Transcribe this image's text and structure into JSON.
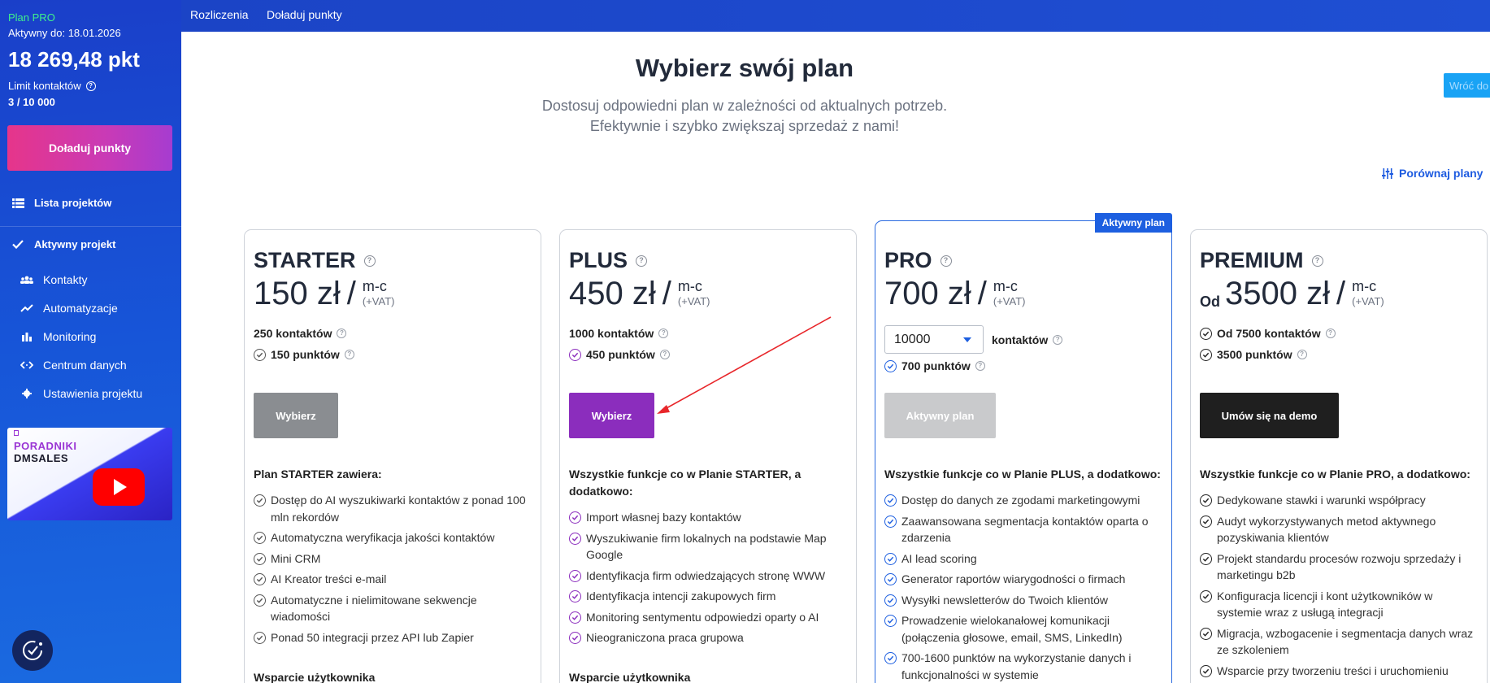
{
  "sidebar": {
    "plan_name": "Plan PRO",
    "active_until": "Aktywny do: 18.01.2026",
    "points": "18 269,48 pkt",
    "limit_label": "Limit kontaktów",
    "limit_value": "3 / 10 000",
    "topup_button": "Doładuj punkty",
    "project_list": "Lista projektów",
    "active_project": "Aktywny projekt",
    "items": [
      {
        "label": "Kontakty",
        "icon": "contacts-icon"
      },
      {
        "label": "Automatyzacje",
        "icon": "trend-icon"
      },
      {
        "label": "Monitoring",
        "icon": "bar-chart-icon"
      },
      {
        "label": "Centrum danych",
        "icon": "code-arrows-icon"
      },
      {
        "label": "Ustawienia projektu",
        "icon": "gear-icon"
      }
    ],
    "video": {
      "line1": "PORADNIKI",
      "line2": "DMSALES"
    }
  },
  "topbar": {
    "links": [
      "Rozliczenia",
      "Doładuj punkty"
    ]
  },
  "header": {
    "title": "Wybierz swój plan",
    "subtitle_line1": "Dostosuj odpowiedni plan w zależności od aktualnych potrzeb.",
    "subtitle_line2": "Efektywnie i szybko zwiększaj sprzedaż z nami!",
    "back_button": "Wróć do",
    "compare_link": "Porównaj plany"
  },
  "colors": {
    "starter": "#8a8d91",
    "plus": "#8b2dbd",
    "pro": "#1d5fe0",
    "premium": "#222222"
  },
  "plans": {
    "starter": {
      "name": "STARTER",
      "price": "150 zł",
      "per": "m-c",
      "vat": "(+VAT)",
      "contacts": "250  kontaktów",
      "points": "150 punktów",
      "button": "Wybierz",
      "features_head": "Plan STARTER zawiera:",
      "features": [
        "Dostęp do AI wyszukiwarki kontaktów z ponad 100 mln rekordów",
        "Automatyczna weryfikacja jakości kontaktów",
        "Mini CRM",
        "AI Kreator treści e-mail",
        "Automatyczne i nielimitowane sekwencje wiadomości",
        "Ponad 50 integracji przez API lub Zapier"
      ],
      "support": "Wsparcie użytkownika"
    },
    "plus": {
      "name": "PLUS",
      "price": "450 zł",
      "per": "m-c",
      "vat": "(+VAT)",
      "contacts": "1000  kontaktów",
      "points": "450 punktów",
      "button": "Wybierz",
      "features_head": "Wszystkie funkcje co w Planie STARTER, a dodatkowo:",
      "features": [
        "Import własnej bazy kontaktów",
        "Wyszukiwanie firm lokalnych na podstawie Map Google",
        "Identyfikacja firm odwiedzających stronę WWW",
        "Identyfikacja intencji zakupowych firm",
        "Monitoring sentymentu odpowiedzi oparty o AI",
        "Nieograniczona praca grupowa"
      ],
      "support": "Wsparcie użytkownika"
    },
    "pro": {
      "name": "PRO",
      "price": "700 zł",
      "per": "m-c",
      "vat": "(+VAT)",
      "badge": "Aktywny plan",
      "select_value": "10000",
      "contacts_label": "kontaktów",
      "points": "700 punktów",
      "button": "Aktywny plan",
      "features_head": "Wszystkie funkcje co w Planie PLUS, a dodatkowo:",
      "features": [
        "Dostęp do danych ze zgodami marketingowymi",
        "Zaawansowana segmentacja kontaktów oparta o zdarzenia",
        "AI lead scoring",
        "Generator raportów wiarygodności o firmach",
        "Wysyłki newsletterów do Twoich klientów",
        "Prowadzenie wielokanałowej komunikacji (połączenia głosowe, email, SMS, LinkedIn)",
        "700-1600 punktów na wykorzystanie danych i funkcjonalności w systemie"
      ]
    },
    "premium": {
      "name": "PREMIUM",
      "od": "Od",
      "price": "3500 zł",
      "per": "m-c",
      "vat": "(+VAT)",
      "contacts": "Od 7500  kontaktów",
      "points": "3500 punktów",
      "button": "Umów się na demo",
      "features_head": "Wszystkie funkcje co w Planie PRO, a dodatkowo:",
      "features": [
        "Dedykowane stawki i warunki współpracy",
        "Audyt wykorzystywanych metod aktywnego pozyskiwania klientów",
        "Projekt standardu procesów rozwoju sprzedaży i marketingu b2b",
        "Konfiguracja licencji i kont użytkowników w systemie wraz z usługą integracji",
        "Migracja, wzbogacenie i segmentacja danych wraz ze szkoleniem",
        "Wsparcie przy tworzeniu treści i uruchomieniu"
      ]
    }
  }
}
